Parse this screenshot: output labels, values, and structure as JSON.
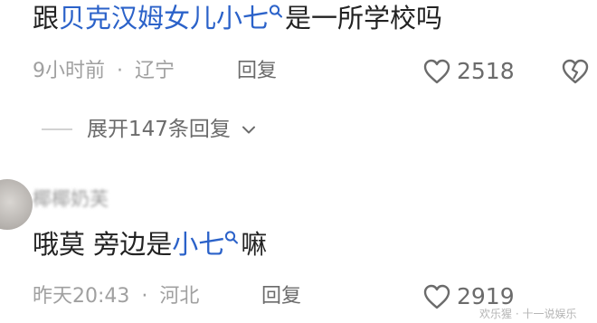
{
  "comments": [
    {
      "text_prefix": "跟",
      "link_text": "贝克汉姆女儿小七",
      "text_suffix": "是一所学校吗",
      "time": "9小时前",
      "separator": "·",
      "location": "辽宁",
      "reply_label": "回复",
      "like_count": "2518",
      "expand_label": "展开147条回复"
    },
    {
      "username": "椰椰奶芙",
      "text_prefix": "哦莫 旁边是",
      "link_text": "小七",
      "text_suffix": "嘛",
      "time": "昨天20:43",
      "separator": "·",
      "location": "河北",
      "reply_label": "回复",
      "like_count": "2919"
    }
  ],
  "watermark": "欢乐猩 · 十一说娱乐",
  "icons": [
    "search-icon",
    "heart-icon",
    "broken-heart-icon",
    "chevron-down-icon"
  ],
  "colors": {
    "link": "#2b62c9",
    "meta": "#a0a0a0",
    "text": "#222222"
  }
}
